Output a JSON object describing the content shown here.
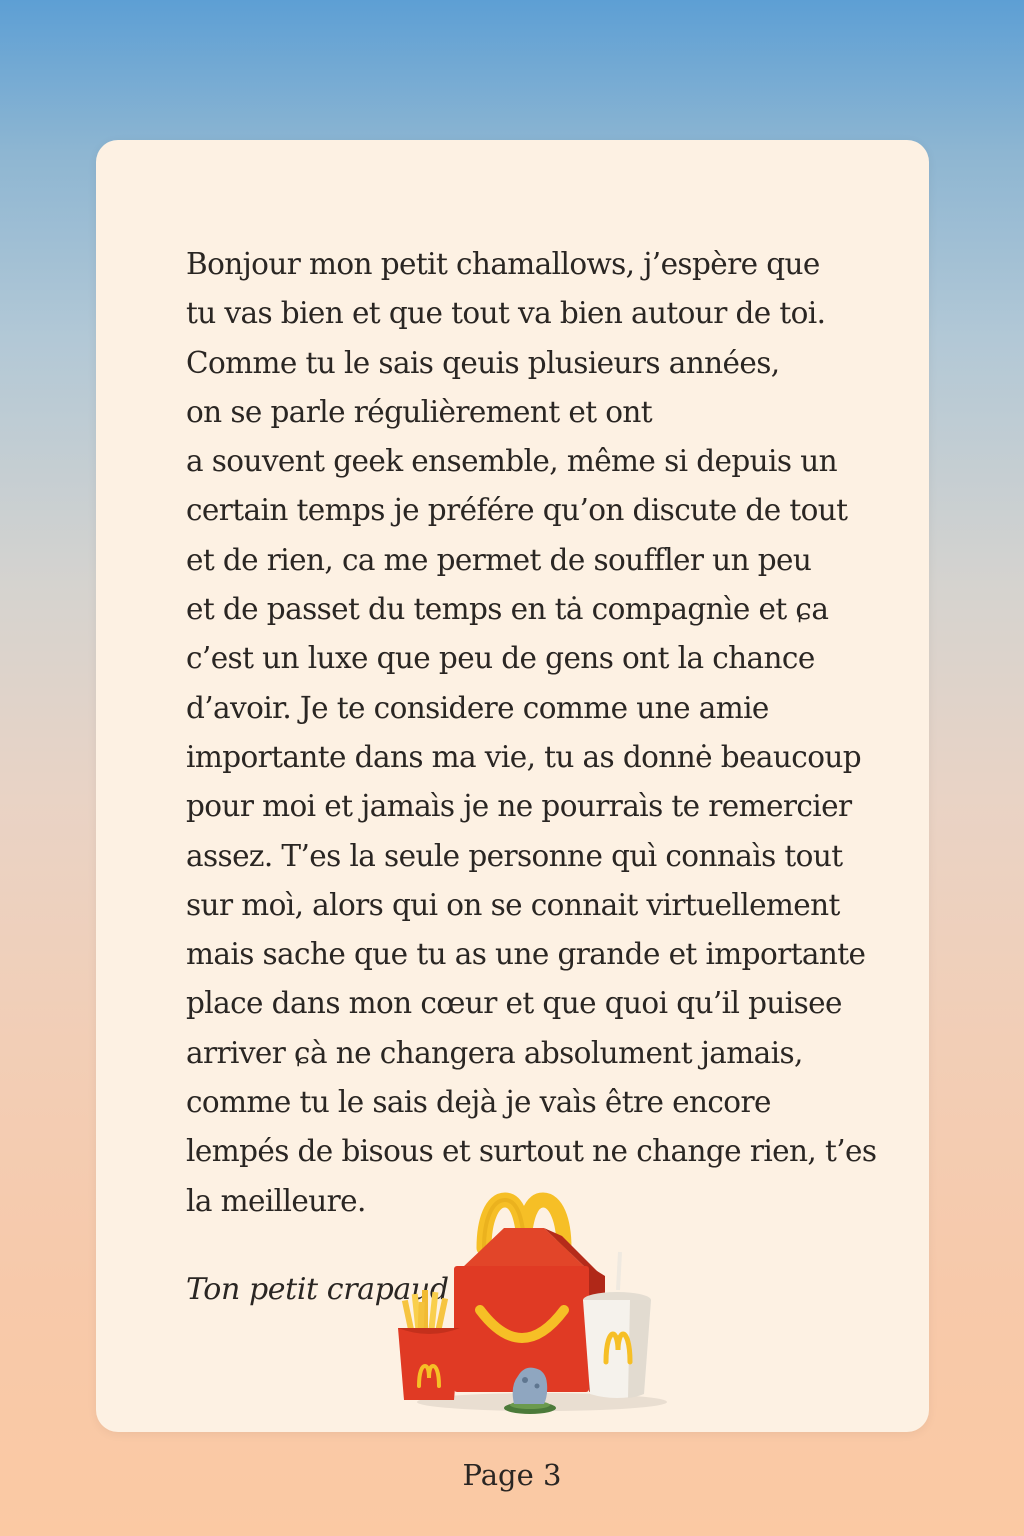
{
  "letter": {
    "lines": [
      "Bonjour mon petit chamallows, j’espère que",
      "tu vas bien et que tout va bien autour de toi.",
      "Comme tu le sais qeuis plusieurs années,",
      "on se parle régulièrement et ont",
      "a souvent geek ensemble, même si depuis un",
      "certain temps je préfére qu’on discute de tout",
      "et de rien, ca me permet de souffler un peu",
      "et de passet du temps en tȧ compagnìe et ɕa",
      "c’est un luxe que peu  de gens ont la chance",
      "d’avoir. Je te considere comme une amie",
      "importante dans ma vie, tu as donnė beaucoup",
      "pour moi et jamaìs je ne pourraìs te remercier",
      "assez. T’es la seule personne quì connaìs tout",
      "sur moì, alors qui on se connait virtuellement",
      "mais sache que tu as une grande et importante",
      "place dans mon cœur et que quoi qu’il puisee",
      "arriver ɕà ne changera absolument jamais,",
      "comme tu le sais dejà je vaìs être encore",
      "lempés de bisous et surtout ne change rien, t’es",
      "la meilleure."
    ],
    "signature": "Ton petit crapaud"
  },
  "illustration": {
    "name": "happy-meal-illustration",
    "logo_letter": "M",
    "colors": {
      "box_red": "#e03a24",
      "arches_yellow": "#f6bf26",
      "cup_white": "#f5f2ec",
      "toy_blue": "#8fa6c0",
      "grass_green": "#4b7a3a"
    }
  },
  "footer": {
    "page_label": "Page 3"
  }
}
